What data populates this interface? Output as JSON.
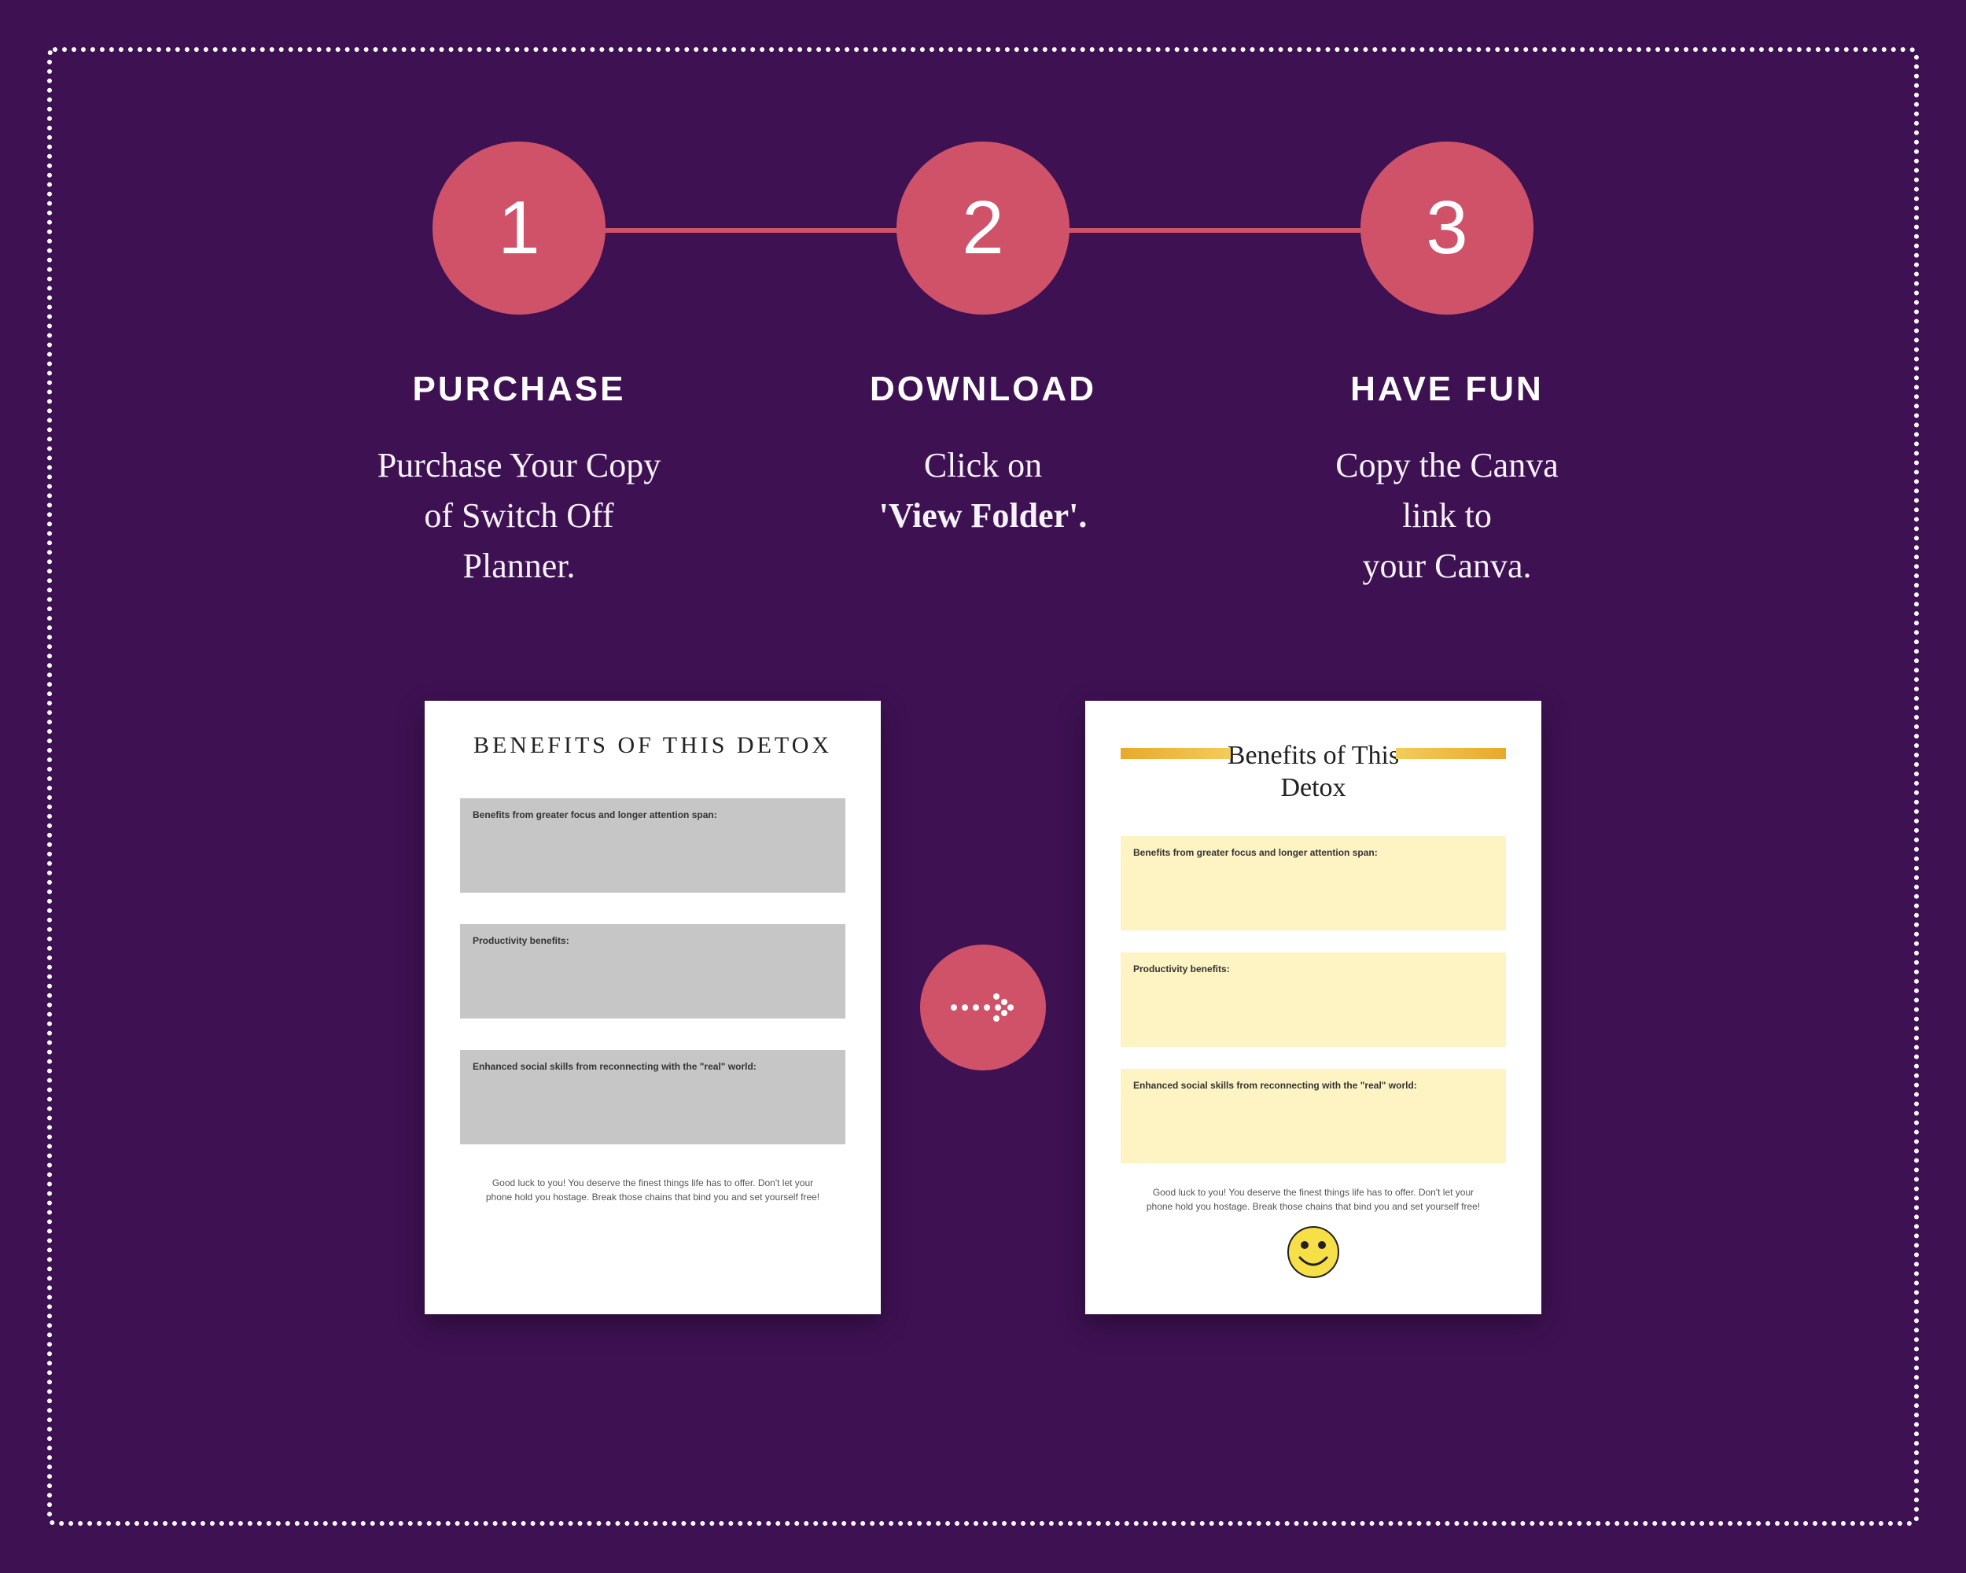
{
  "steps": [
    {
      "number": "1",
      "title": "PURCHASE",
      "desc_lines": [
        "Purchase Your Copy",
        "of Switch Off",
        "Planner."
      ]
    },
    {
      "number": "2",
      "title": "DOWNLOAD",
      "desc_lines": [
        "Click  on"
      ],
      "desc_bold": "'View Folder'.",
      "trailing_lines": []
    },
    {
      "number": "3",
      "title": "HAVE FUN",
      "desc_lines": [
        "Copy the Canva",
        "link to",
        "your Canva."
      ]
    }
  ],
  "page_a": {
    "title": "BENEFITS OF THIS DETOX",
    "box1": "Benefits from greater focus and longer attention span:",
    "box2": "Productivity benefits:",
    "box3": "Enhanced social skills from reconnecting with the \"real\" world:",
    "footer": "Good luck to you! You deserve the finest things life has to offer. Don't let your phone hold you hostage. Break those chains that bind you and set yourself free!"
  },
  "page_b": {
    "title": "Benefits of This Detox",
    "box1": "Benefits from greater focus and longer attention span:",
    "box2": "Productivity benefits:",
    "box3": "Enhanced social skills from reconnecting with the \"real\" world:",
    "footer": "Good luck to you! You deserve the finest things life has to offer. Don't let your phone hold you hostage. Break those chains that bind you and set yourself free!"
  }
}
